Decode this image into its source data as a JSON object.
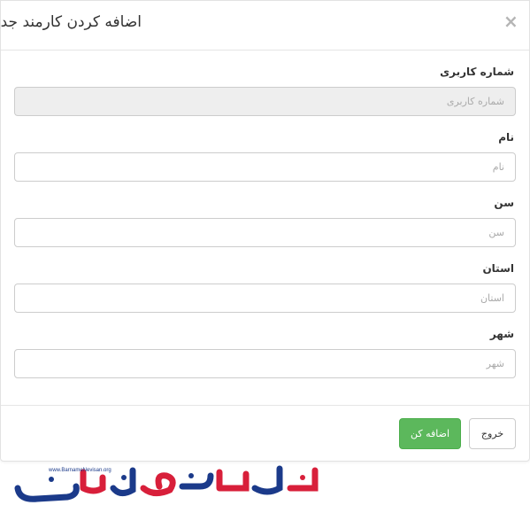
{
  "dialog": {
    "title": "اضافه کردن کارمند جدید",
    "close_symbol": "×"
  },
  "form": {
    "fields": [
      {
        "label": "شماره کاربری",
        "placeholder": "شماره کاربری",
        "disabled": true
      },
      {
        "label": "نام",
        "placeholder": "نام",
        "disabled": false
      },
      {
        "label": "سن",
        "placeholder": "سن",
        "disabled": false
      },
      {
        "label": "استان",
        "placeholder": "استان",
        "disabled": false
      },
      {
        "label": "شهر",
        "placeholder": "شهر",
        "disabled": false
      }
    ]
  },
  "footer": {
    "exit_label": "خروج",
    "add_label": "اضافه کن"
  },
  "branding": {
    "url": "www.BarnameNevisan.org",
    "logo_text": "برنامه نویسان",
    "colors": {
      "primary": "#1b3a8a",
      "accent": "#d81f3a",
      "success": "#5cb85c"
    }
  }
}
